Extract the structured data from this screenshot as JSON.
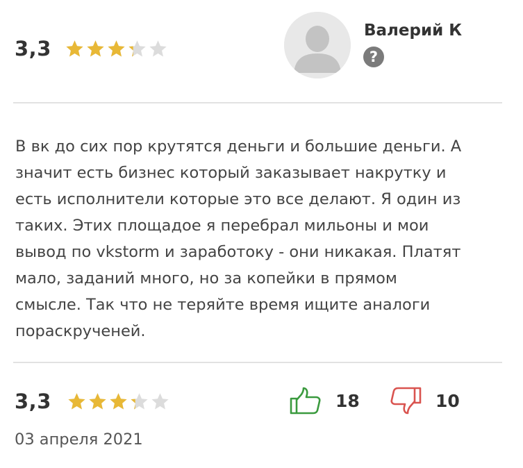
{
  "review": {
    "overall_rating": {
      "score": "3,3",
      "stars_value": 3.3,
      "stars_max": 5
    },
    "author": {
      "name": "Валерий К",
      "avatar_icon": "default-user-avatar-icon",
      "info_icon": "question-icon",
      "info_symbol": "?"
    },
    "text_lines": [
      "В вк до сих пор крутятся деньги и большие деньги. А",
      "значит есть бизнес который заказывает накрутку и",
      "есть исполнители которые это все делают. Я один из",
      "таких. Этих площадое я перебрал мильоны и мои",
      "вывод по vkstorm и заработоку - они никакая. Платят",
      "мало, заданий много, но за копейки в прямом",
      "смысле. Так что не теряйте время ищите аналоги",
      "пораскрученей."
    ],
    "footer": {
      "rating": {
        "score": "3,3",
        "stars_value": 3.3,
        "stars_max": 5
      },
      "likes": {
        "icon": "thumbs-up-icon",
        "count": "18",
        "color": "#3a9a3e"
      },
      "dislikes": {
        "icon": "thumbs-down-icon",
        "count": "10",
        "color": "#d9534f"
      },
      "date": "03 апреля 2021"
    }
  },
  "colors": {
    "star_filled": "#e8b836",
    "star_empty": "#dcdcdc",
    "divider": "#e2e2e2",
    "text": "#444444"
  }
}
